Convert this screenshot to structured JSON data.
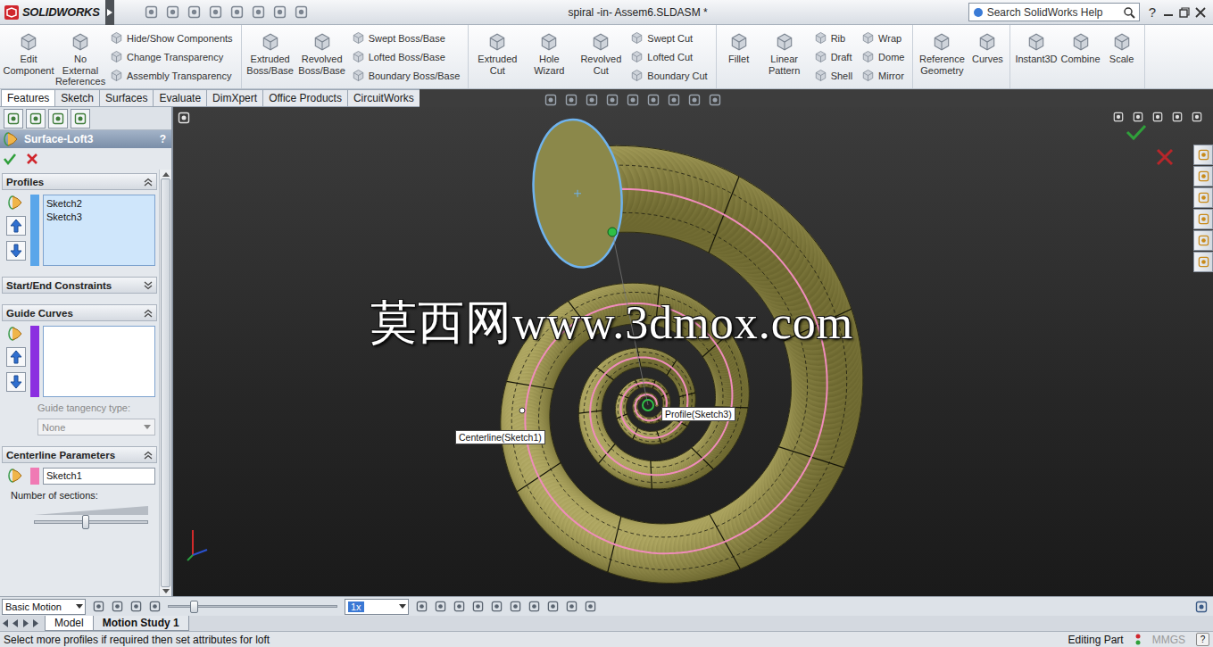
{
  "window": {
    "app": "SOLIDWORKS",
    "title": "spiral -in- Assem6.SLDASM *",
    "search_placeholder": "Search SolidWorks Help",
    "help": "?"
  },
  "ribbon": [
    {
      "items": [
        {
          "kind": "large",
          "label": "Edit Component"
        },
        {
          "kind": "large",
          "label": "No External References"
        },
        {
          "kind": "stack",
          "labels": [
            "Hide/Show Components",
            "Change Transparency",
            "Assembly Transparency"
          ]
        }
      ]
    },
    {
      "items": [
        {
          "kind": "large",
          "label": "Extruded Boss/Base"
        },
        {
          "kind": "large",
          "label": "Revolved Boss/Base"
        },
        {
          "kind": "stack",
          "labels": [
            "Swept Boss/Base",
            "Lofted Boss/Base",
            "Boundary Boss/Base"
          ]
        }
      ]
    },
    {
      "items": [
        {
          "kind": "large",
          "label": "Extruded Cut"
        },
        {
          "kind": "large",
          "label": "Hole Wizard"
        },
        {
          "kind": "large",
          "label": "Revolved Cut"
        },
        {
          "kind": "stack",
          "labels": [
            "Swept Cut",
            "Lofted Cut",
            "Boundary Cut"
          ]
        }
      ]
    },
    {
      "items": [
        {
          "kind": "large",
          "label": "Fillet"
        },
        {
          "kind": "large",
          "label": "Linear Pattern"
        },
        {
          "kind": "stack",
          "labels": [
            "Rib",
            "Draft",
            "Shell"
          ]
        },
        {
          "kind": "stack",
          "labels": [
            "Wrap",
            "Dome",
            "Mirror"
          ]
        }
      ]
    },
    {
      "items": [
        {
          "kind": "large",
          "label": "Reference Geometry"
        },
        {
          "kind": "large",
          "label": "Curves"
        }
      ]
    },
    {
      "items": [
        {
          "kind": "large",
          "label": "Instant3D"
        },
        {
          "kind": "large",
          "label": "Combine"
        },
        {
          "kind": "large",
          "label": "Scale"
        }
      ]
    }
  ],
  "command_tabs": [
    {
      "label": "Features",
      "selected": true
    },
    {
      "label": "Sketch",
      "selected": false
    },
    {
      "label": "Surfaces",
      "selected": false
    },
    {
      "label": "Evaluate",
      "selected": false
    },
    {
      "label": "DimXpert",
      "selected": false
    },
    {
      "label": "Office Products",
      "selected": false
    },
    {
      "label": "CircuitWorks",
      "selected": false
    }
  ],
  "property_manager": {
    "title": "Surface-Loft3",
    "help": "?",
    "sections": [
      {
        "kind": "profiles",
        "title": "Profiles",
        "expanded": true,
        "color": "#5aa6ea",
        "items": [
          "Sketch2",
          "Sketch3"
        ]
      },
      {
        "kind": "constraints",
        "title": "Start/End Constraints",
        "expanded": false
      },
      {
        "kind": "guides",
        "title": "Guide Curves",
        "expanded": true,
        "color": "#8b2fe0",
        "items": [],
        "tangency_label": "Guide tangency type:",
        "tangency_value": "None",
        "tangency_disabled": true
      },
      {
        "kind": "centerline",
        "title": "Centerline Parameters",
        "expanded": true,
        "color": "#f07ab4",
        "centerline": "Sketch1",
        "sections_label": "Number of sections:",
        "sections_level": 0.45
      }
    ]
  },
  "viewport": {
    "watermark": "莫西网www.3dmox.com",
    "callouts": [
      {
        "label": "Profile(Sketch3)"
      },
      {
        "label": "Centerline(Sketch1)"
      }
    ]
  },
  "motion": {
    "study_type": "Basic Motion",
    "timeline_level": 0.15,
    "speed": "1x"
  },
  "study_tabs": [
    {
      "label": "Model",
      "selected": true
    },
    {
      "label": "Motion Study 1",
      "selected": false
    }
  ],
  "status_bar": {
    "message": "Select more profiles if required then set attributes for loft",
    "mode": "Editing Part",
    "units": "MMGS",
    "units_disabled": true,
    "help": "?"
  }
}
